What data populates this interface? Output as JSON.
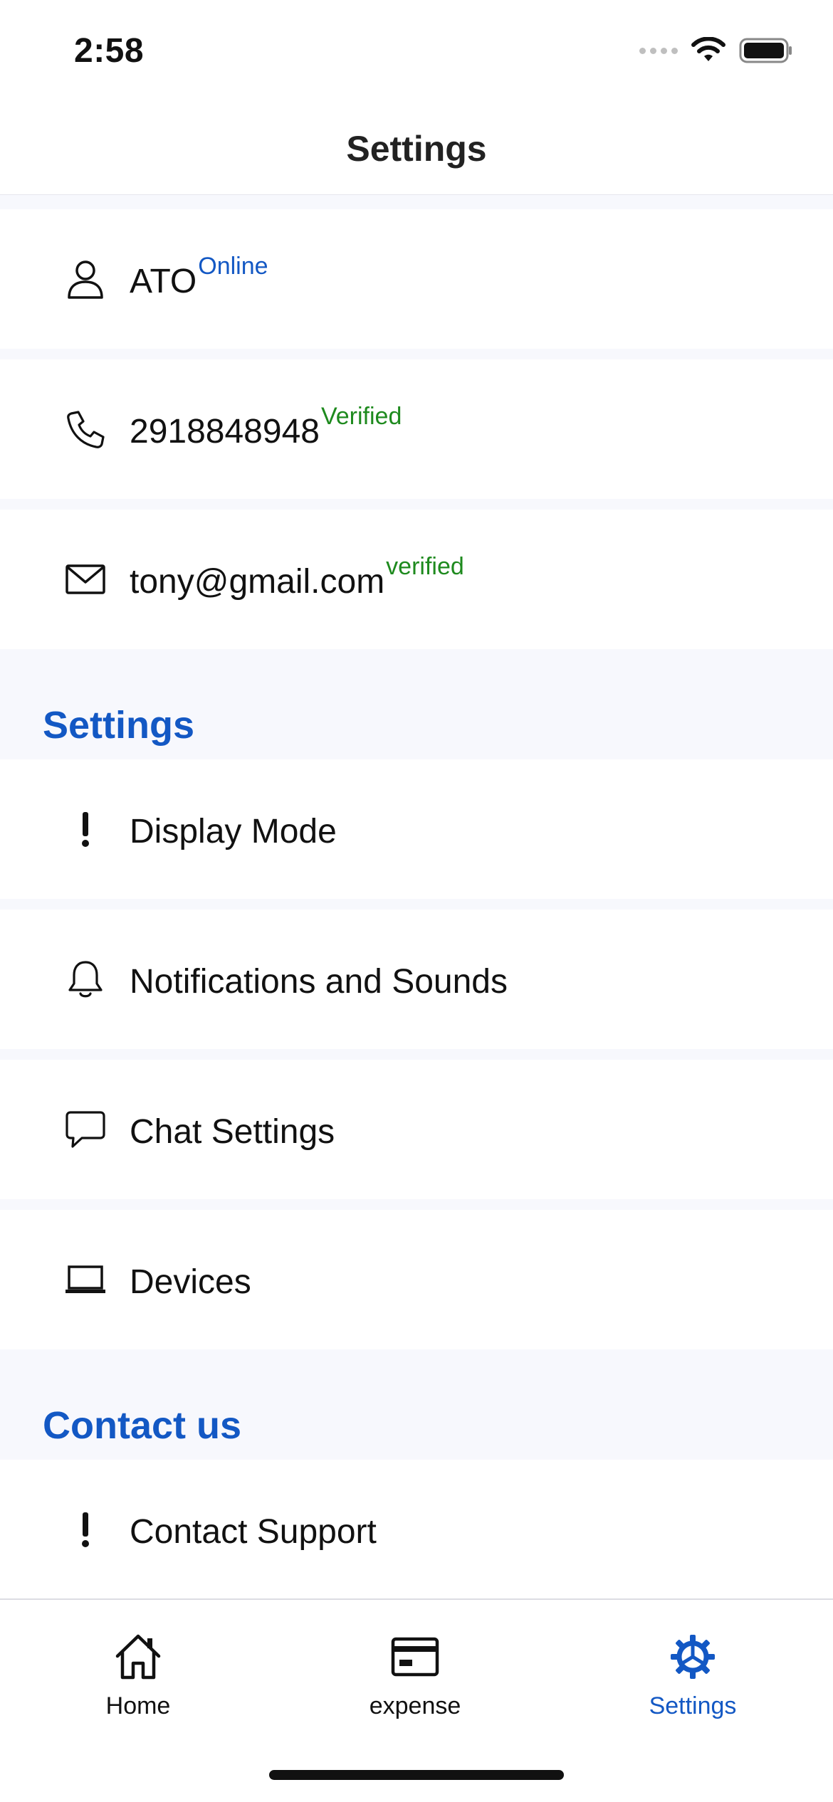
{
  "status_bar": {
    "time": "2:58"
  },
  "header": {
    "title": "Settings"
  },
  "profile": {
    "name": "ATO",
    "name_badge": "Online",
    "phone": "2918848948",
    "phone_badge": "Verified",
    "email": "tony@gmail.com",
    "email_badge": "verified"
  },
  "settings_section": {
    "title": "Settings",
    "items": [
      {
        "label": "Display Mode",
        "icon": "exclamation-icon"
      },
      {
        "label": "Notifications and Sounds",
        "icon": "bell-icon"
      },
      {
        "label": "Chat Settings",
        "icon": "chat-bubble-icon"
      },
      {
        "label": "Devices",
        "icon": "laptop-icon"
      }
    ]
  },
  "contact_section": {
    "title": "Contact us",
    "items": [
      {
        "label": "Contact Support",
        "icon": "exclamation-icon"
      }
    ]
  },
  "tab_bar": {
    "tabs": [
      {
        "label": "Home",
        "icon": "home-icon",
        "active": false
      },
      {
        "label": "expense",
        "icon": "card-icon",
        "active": false
      },
      {
        "label": "Settings",
        "icon": "gear-icon",
        "active": true
      }
    ]
  },
  "colors": {
    "accent": "#1358c4",
    "verified": "#1e8a1e",
    "background": "#f7f8fd"
  }
}
